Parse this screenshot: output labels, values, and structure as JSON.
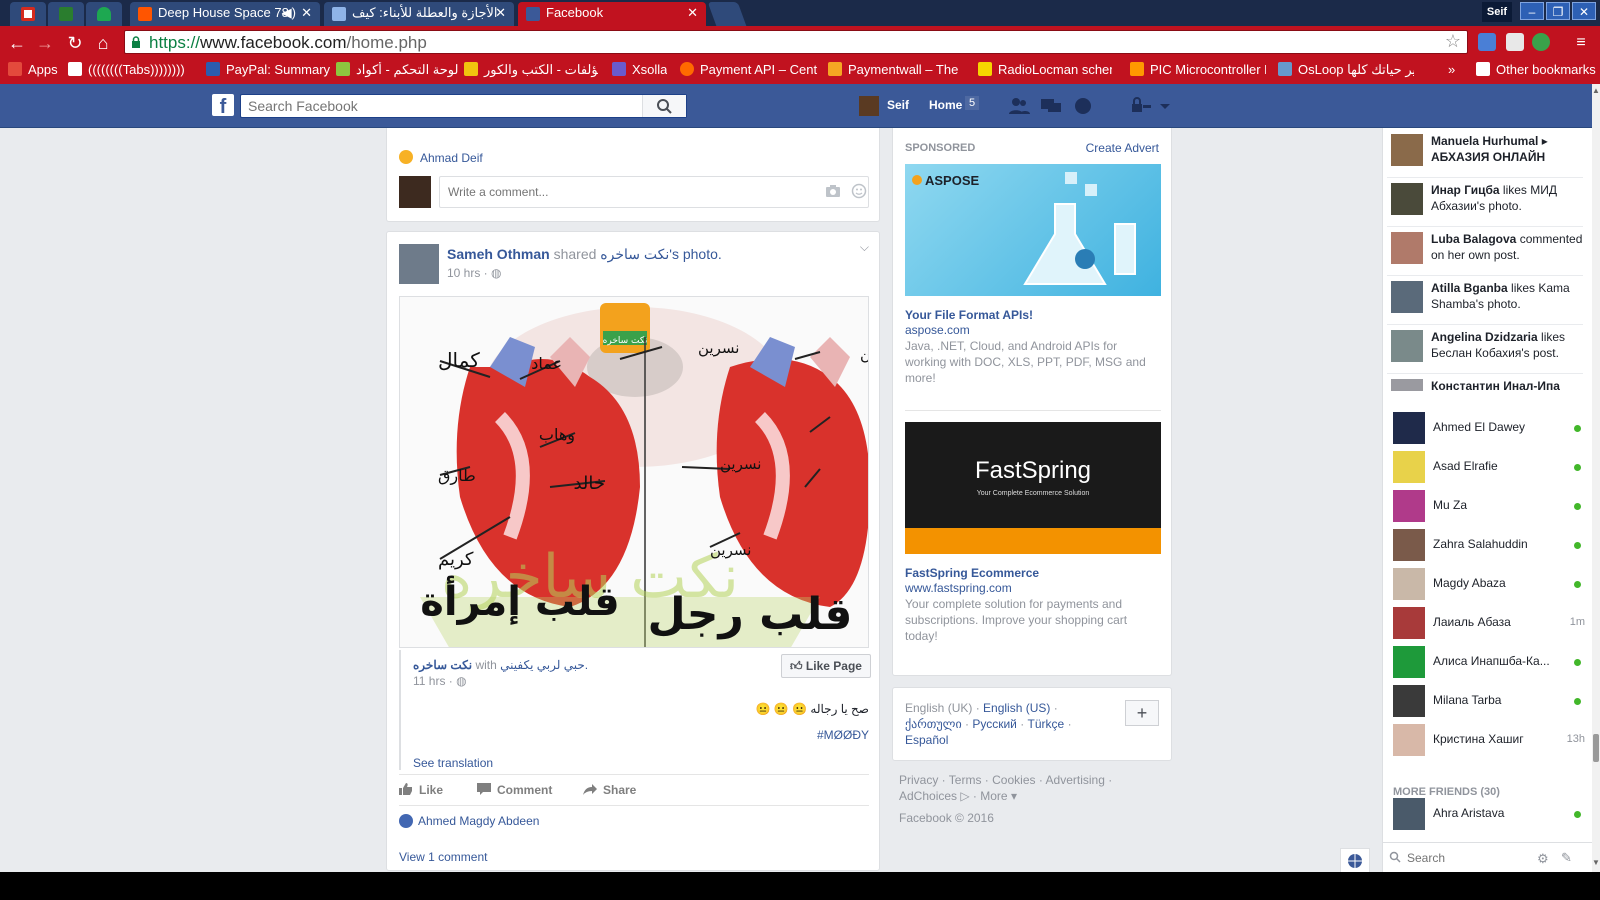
{
  "browser": {
    "tabs": [
      {
        "title": "",
        "favicon_color": "#d52b1e",
        "icon": "flag-icon"
      },
      {
        "title": "",
        "favicon_color": "#2a7d2e",
        "icon": "rt-icon"
      },
      {
        "title": "",
        "favicon_color": "#1da851",
        "icon": "wifi-icon"
      },
      {
        "title": "Deep House Space 78",
        "favicon_color": "#ff5500",
        "icon": "soundcloud-icon"
      },
      {
        "title": "الأجازة والعطلة للأبناء: كيف",
        "favicon_color": "#8fb4e8",
        "icon": "site-icon"
      },
      {
        "title": "Facebook",
        "favicon_color": "#3b5998",
        "icon": "facebook-icon"
      }
    ],
    "window_user": "Seif",
    "url": {
      "scheme": "https://",
      "domain": "www.facebook.com",
      "path": "/home.php"
    },
    "bookmarks": [
      {
        "label": "Apps",
        "color": "#e34a3c"
      },
      {
        "label": "((((((((Tabs))))))))",
        "color": "#ffffff"
      },
      {
        "label": "PayPal: Summary",
        "color": "#2b5caf"
      },
      {
        "label": "لوحة التحكم - أكواد",
        "color": "#8dc63f"
      },
      {
        "label": "مؤلفات - الكتب والكور",
        "color": "#f1c40f"
      },
      {
        "label": "Xsolla",
        "color": "#6a5acd"
      },
      {
        "label": "Payment API – Centi",
        "color": "#ff6a00"
      },
      {
        "label": "Paymentwall – The e",
        "color": "#f5a623"
      },
      {
        "label": "RadioLocman schem",
        "color": "#f6d500"
      },
      {
        "label": "PIC Microcontroller F",
        "color": "#ff9900"
      },
      {
        "label": "OsLoop لمير حياتك كلها",
        "color": "#6699cc"
      },
      {
        "label": "Other bookmarks",
        "color": "#ffffff"
      }
    ],
    "bookmarks_overflow": "»"
  },
  "fb": {
    "search_placeholder": "Search Facebook",
    "user": "Seif",
    "home_label": "Home",
    "home_count": "5"
  },
  "feed": {
    "prev_post": {
      "reaction_name": "Ahmad Deif",
      "comment_placeholder": "Write a comment..."
    },
    "post": {
      "author": "Sameh Othman",
      "verb": "shared",
      "page": "نكت ساخره",
      "object": "'s photo.",
      "time": "10 hrs · ",
      "shared_page": "نكت ساخره",
      "shared_with": "with",
      "shared_friend": "حبي لربي يكفيني.",
      "shared_time": "11 hrs · ",
      "like_page": "Like Page",
      "text": "صح يا رجاله 😐 😐 😐",
      "hashtag": "#MØØÐY",
      "see_translation": "See translation",
      "actions": {
        "like": "Like",
        "comment": "Comment",
        "share": "Share"
      },
      "likers": "Ahmed Magdy Abdeen",
      "view_comments": "View 1 comment",
      "image_labels": {
        "left_top": "كمال",
        "left_mid": "طارق",
        "left_bottom": "كريم",
        "emad": "عماد",
        "wahab": "وهاب",
        "khaled": "خالد",
        "nesrine": "نسرين",
        "heart_woman": "قلب إمرأة",
        "heart_man": "قلب رجل",
        "watermark": "نكت ساخره",
        "logo_top": "نكت ساخره"
      }
    }
  },
  "ads": {
    "sponsored": "SPONSORED",
    "create_advert": "Create Advert",
    "items": [
      {
        "brand": "ASPOSE",
        "title": "Your File Format APIs!",
        "domain": "aspose.com",
        "desc": "Java, .NET, Cloud, and Android APIs for working with DOC, XLS, PPT, PDF, MSG and more!"
      },
      {
        "brand": "FastSpring",
        "tagline": "Your Complete Ecommerce Solution",
        "title": "FastSpring Ecommerce",
        "domain": "www.fastspring.com",
        "desc": "Your complete solution for payments and subscriptions. Improve your shopping cart today!"
      }
    ],
    "languages": {
      "current": "English (UK)",
      "others": [
        "English (US)",
        "ქართული",
        "Русский",
        "Türkçe",
        "Español"
      ],
      "plus": "+"
    },
    "footer": {
      "links": [
        "Privacy",
        "Terms",
        "Cookies",
        "Advertising",
        "AdChoices",
        "More"
      ],
      "copyright": "Facebook © 2016"
    }
  },
  "sidebar": {
    "ticker": [
      {
        "name": "Manuela Hurhumal",
        "rest": " ▸ ",
        "extra": "АБХАЗИЯ ОНЛАЙН",
        "avatar": "#8a6a4a"
      },
      {
        "name": "Инар Гицба",
        "rest": " likes МИД Абхазии's photo.",
        "avatar": "#4a4a3a"
      },
      {
        "name": "Luba Balagova",
        "rest": " commented on her own post.",
        "avatar": "#b07a6a"
      },
      {
        "name": "Atilla Bganba",
        "rest": " likes Kama Shamba's photo.",
        "avatar": "#5a6a7a"
      },
      {
        "name": "Angelina Dzidzaria",
        "rest": " likes Беслан Кобахия's post.",
        "avatar": "#7a8a8a"
      },
      {
        "name": "Константин Инал-Ипа",
        "rest": "",
        "avatar": "#9a9aa0"
      }
    ],
    "buddies": [
      {
        "name": "Ahmed El Dawey",
        "status": "online",
        "ago": "",
        "avatar": "#1f2a4a"
      },
      {
        "name": "Asad Elrafie",
        "status": "online",
        "ago": "",
        "avatar": "#e8d24a"
      },
      {
        "name": "Mu Za",
        "status": "online",
        "ago": "",
        "avatar": "#b03a8a"
      },
      {
        "name": "Zahra Salahuddin",
        "status": "online",
        "ago": "",
        "avatar": "#7a5a4a"
      },
      {
        "name": "Magdy Abaza",
        "status": "online",
        "ago": "",
        "avatar": "#c9b8a8"
      },
      {
        "name": "Лаиаль Абаза",
        "status": "idle",
        "ago": "1m",
        "avatar": "#a83a3a"
      },
      {
        "name": "Алиса Инапшба-Ка...",
        "status": "online",
        "ago": "",
        "avatar": "#1e9a3a"
      },
      {
        "name": "Milana Tarba",
        "status": "online",
        "ago": "",
        "avatar": "#3a3a3a"
      },
      {
        "name": "Кристина Хашиг",
        "status": "idle",
        "ago": "13h",
        "avatar": "#d8b8a8"
      }
    ],
    "more_friends": "MORE FRIENDS (30)",
    "more_buddies": [
      {
        "name": "Ahra Aristava",
        "status": "online",
        "ago": "",
        "avatar": "#4a5a6a"
      }
    ],
    "search_placeholder": "Search"
  }
}
